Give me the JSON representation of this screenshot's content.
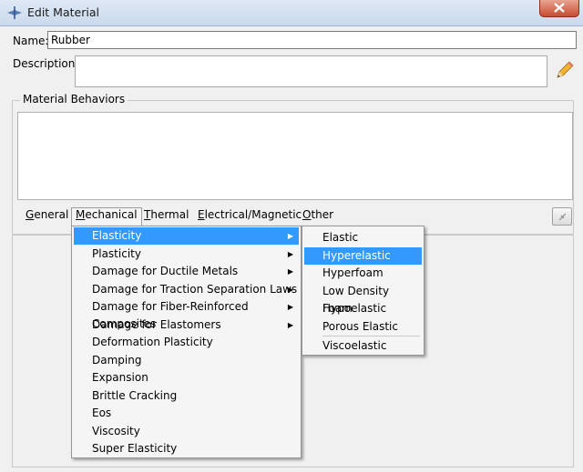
{
  "window": {
    "title": "Edit Material",
    "icon": "abaqus-app-icon"
  },
  "name": {
    "label": "Name:",
    "value": "Rubber"
  },
  "description": {
    "label": "Description:",
    "value": ""
  },
  "behaviors": {
    "title": "Material Behaviors"
  },
  "tabs": [
    {
      "label": "General",
      "underline": "G",
      "rest": "eneral"
    },
    {
      "label": "Mechanical",
      "underline": "M",
      "rest": "echanical"
    },
    {
      "label": "Thermal",
      "underline": "T",
      "rest": "hermal"
    },
    {
      "label": "Electrical/Magnetic",
      "underline": "E",
      "rest": "lectrical/Magnetic"
    },
    {
      "label": "Other",
      "underline": "O",
      "rest": "ther"
    }
  ],
  "mechanical_menu": [
    {
      "label": "Elasticity",
      "submenu": true,
      "highlighted": true
    },
    {
      "label": "Plasticity",
      "submenu": true
    },
    {
      "label": "Damage for Ductile Metals",
      "submenu": true
    },
    {
      "label": "Damage for Traction Separation Laws",
      "submenu": true
    },
    {
      "label": "Damage for Fiber-Reinforced Composites",
      "submenu": true
    },
    {
      "label": "Damage for Elastomers",
      "submenu": true
    },
    {
      "label": "Deformation Plasticity",
      "submenu": false
    },
    {
      "label": "Damping",
      "submenu": false
    },
    {
      "label": "Expansion",
      "submenu": false
    },
    {
      "label": "Brittle Cracking",
      "submenu": false
    },
    {
      "label": "Eos",
      "submenu": false
    },
    {
      "label": "Viscosity",
      "submenu": false
    },
    {
      "label": "Super Elasticity",
      "submenu": false
    }
  ],
  "elasticity_submenu": [
    {
      "label": "Elastic"
    },
    {
      "label": "Hyperelastic",
      "highlighted": true
    },
    {
      "label": "Hyperfoam"
    },
    {
      "label": "Low Density Foam"
    },
    {
      "label": "Hypoelastic"
    },
    {
      "label": "Porous Elastic"
    },
    {
      "label": "Viscoelastic"
    }
  ],
  "colors": {
    "highlight": "#3399ff",
    "titlebar": "#c9d9ec",
    "close": "#c84b30"
  }
}
